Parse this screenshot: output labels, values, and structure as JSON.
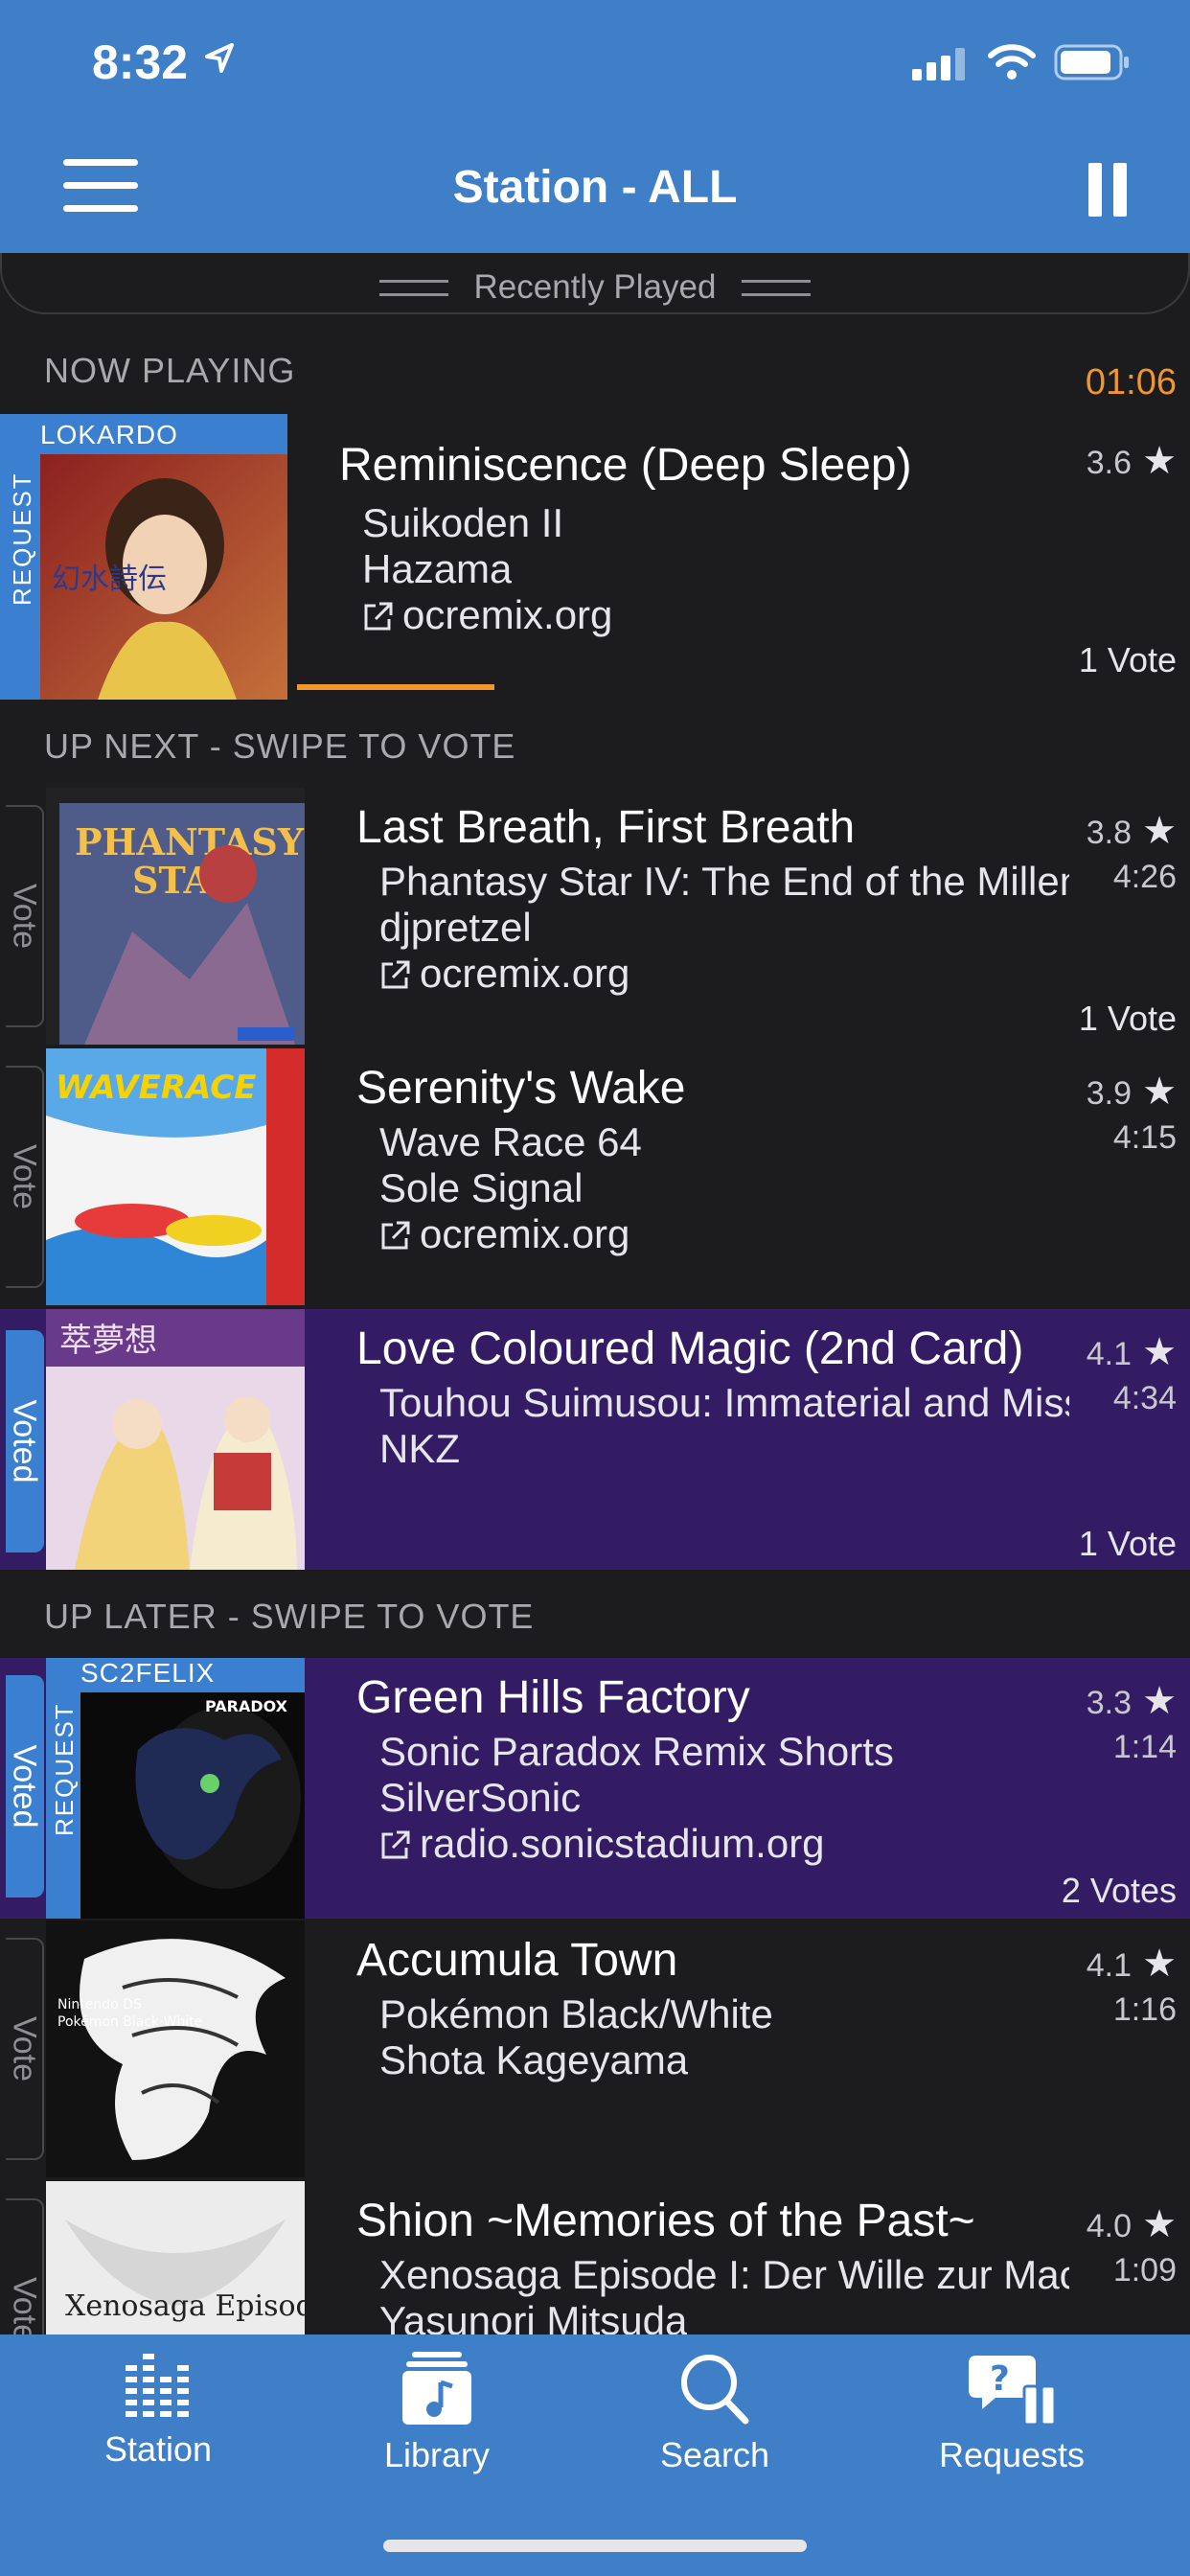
{
  "status_bar": {
    "time": "8:32"
  },
  "header": {
    "title": "Station - ALL"
  },
  "recently_played": {
    "label": "Recently Played"
  },
  "now_playing": {
    "section_label": "NOW PLAYING",
    "elapsed": "01:06",
    "requester": "LOKARDO",
    "request_tag": "REQUEST",
    "title": "Reminiscence (Deep Sleep)",
    "game": "Suikoden II",
    "artist": "Hazama",
    "source": "ocremix.org",
    "rating": "3.6",
    "votes": "1 Vote",
    "progress": 0.17
  },
  "up_next": {
    "section_label": "UP NEXT - SWIPE TO VOTE",
    "items": [
      {
        "title": "Last Breath, First Breath",
        "game": "Phantasy Star IV: The End of the Millennium",
        "artist": "djpretzel",
        "source": "ocremix.org",
        "rating": "3.8",
        "duration": "4:26",
        "votes": "1 Vote",
        "vote_label": "Vote"
      },
      {
        "title": "Serenity's Wake",
        "game": "Wave Race 64",
        "artist": "Sole Signal",
        "source": "ocremix.org",
        "rating": "3.9",
        "duration": "4:15",
        "votes": "",
        "vote_label": "Vote"
      },
      {
        "title": "Love Coloured Magic (2nd Card)",
        "game": "Touhou Suimusou: Immaterial and Missing Power",
        "artist": "NKZ",
        "source": "",
        "rating": "4.1",
        "duration": "4:34",
        "votes": "1 Vote",
        "vote_label": "Voted"
      }
    ]
  },
  "up_later": {
    "section_label": "UP LATER - SWIPE TO VOTE",
    "items": [
      {
        "title": "Green Hills Factory",
        "game": "Sonic Paradox Remix Shorts",
        "artist": "SilverSonic",
        "source": "radio.sonicstadium.org",
        "rating": "3.3",
        "duration": "1:14",
        "votes": "2 Votes",
        "vote_label": "Voted",
        "requester": "SC2FELIX",
        "request_tag": "REQUEST"
      },
      {
        "title": "Accumula Town",
        "game": "Pokémon Black/White",
        "artist": "Shota Kageyama",
        "source": "",
        "rating": "4.1",
        "duration": "1:16",
        "votes": "",
        "vote_label": "Vote"
      },
      {
        "title": "Shion ~Memories of the Past~",
        "game": "Xenosaga Episode I: Der Wille zur Macht",
        "artist": "Yasunori Mitsuda",
        "source": "",
        "rating": "4.0",
        "duration": "1:09",
        "votes": "",
        "vote_label": "Vote"
      }
    ]
  },
  "tabs": [
    {
      "label": "Station",
      "icon": "equalizer-icon"
    },
    {
      "label": "Library",
      "icon": "music-library-icon"
    },
    {
      "label": "Search",
      "icon": "search-icon"
    },
    {
      "label": "Requests",
      "icon": "requests-icon"
    }
  ],
  "colors": {
    "header_blue": "#3e7fc8",
    "voted_purple": "#341c64",
    "elapsed_orange": "#f0962c",
    "vote_tab_blue": "#3a7fd0"
  }
}
